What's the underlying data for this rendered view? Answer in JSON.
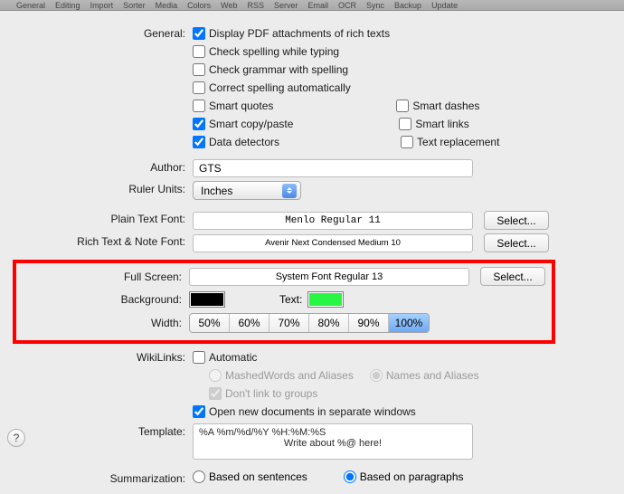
{
  "tabs": [
    "General",
    "Editing",
    "Import",
    "Sorter",
    "Media",
    "Colors",
    "Web",
    "RSS",
    "Server",
    "Email",
    "OCR",
    "Sync",
    "Backup",
    "Update"
  ],
  "general": {
    "label": "General:",
    "opts": {
      "display_pdf": "Display PDF attachments of rich texts",
      "check_spelling_typing": "Check spelling while typing",
      "check_grammar": "Check grammar with spelling",
      "correct_spelling": "Correct spelling automatically",
      "smart_quotes": "Smart quotes",
      "smart_dashes": "Smart dashes",
      "smart_copy_paste": "Smart copy/paste",
      "smart_links": "Smart links",
      "data_detectors": "Data detectors",
      "text_replacement": "Text replacement"
    }
  },
  "author": {
    "label": "Author:",
    "value": "GTS"
  },
  "ruler": {
    "label": "Ruler Units:",
    "value": "Inches"
  },
  "plainfont": {
    "label": "Plain Text Font:",
    "value": "Menlo Regular 11",
    "select_btn": "Select..."
  },
  "richfont": {
    "label": "Rich Text & Note Font:",
    "value": "Avenir Next Condensed Medium 10",
    "select_btn": "Select..."
  },
  "full_screen": {
    "label": "Full Screen:",
    "value": "System Font Regular 13",
    "select_btn": "Select...",
    "background_label": "Background:",
    "text_label": "Text:",
    "background_color": "#000000",
    "text_color": "#29f544",
    "width_label": "Width:",
    "widths": [
      "50%",
      "60%",
      "70%",
      "80%",
      "90%",
      "100%"
    ],
    "width_selected": "100%"
  },
  "wikilinks": {
    "label": "WikiLinks:",
    "automatic": "Automatic",
    "mashed": "MashedWords and Aliases",
    "names": "Names and Aliases",
    "dontlink": "Don't link to groups",
    "openwin": "Open new documents in separate windows"
  },
  "template": {
    "label": "Template:",
    "line1": "%A %m/%d/%Y %H:%M:%S",
    "line2": "Write about %@ here!"
  },
  "summarization": {
    "label": "Summarization:",
    "sentences": "Based on sentences",
    "paragraphs": "Based on paragraphs"
  },
  "help": "?"
}
